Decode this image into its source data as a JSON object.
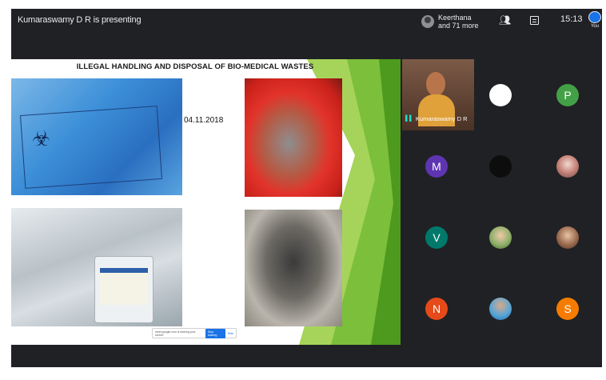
{
  "topbar": {
    "presenting": "Kumaraswamy D R is presenting",
    "viewers_line1": "Keerthana",
    "viewers_line2": "and 71 more",
    "time": "15:13",
    "you_label": "You"
  },
  "slide": {
    "title": "ILLEGAL HANDLING AND DISPOSAL OF BIO-MEDICAL WASTES",
    "date": "04.11.2018",
    "share_text": "meet.google.com is sharing your screen",
    "stop_label": "Stop sharing",
    "hide_label": "Hide"
  },
  "participants": {
    "speaker_name": "Kumaraswamy D R",
    "initials": {
      "p": "P",
      "m": "M",
      "v": "V",
      "n": "N",
      "s": "S"
    }
  },
  "colors": {
    "meet_bg": "#202124",
    "speaker_accent": "#1ee0c8",
    "avatar_white": "#ffffff",
    "avatar_green": "#43a047",
    "avatar_purple": "#5e35b1",
    "avatar_black": "#0d0d0d",
    "avatar_teal": "#00796b",
    "avatar_red": "#e64a19",
    "avatar_orange": "#f57c00",
    "slide_green": "#7cbf3a"
  },
  "icons": [
    "viewer-avatar-icon",
    "people-icon",
    "chat-icon",
    "mic-active-icon",
    "biohazard-icon"
  ]
}
